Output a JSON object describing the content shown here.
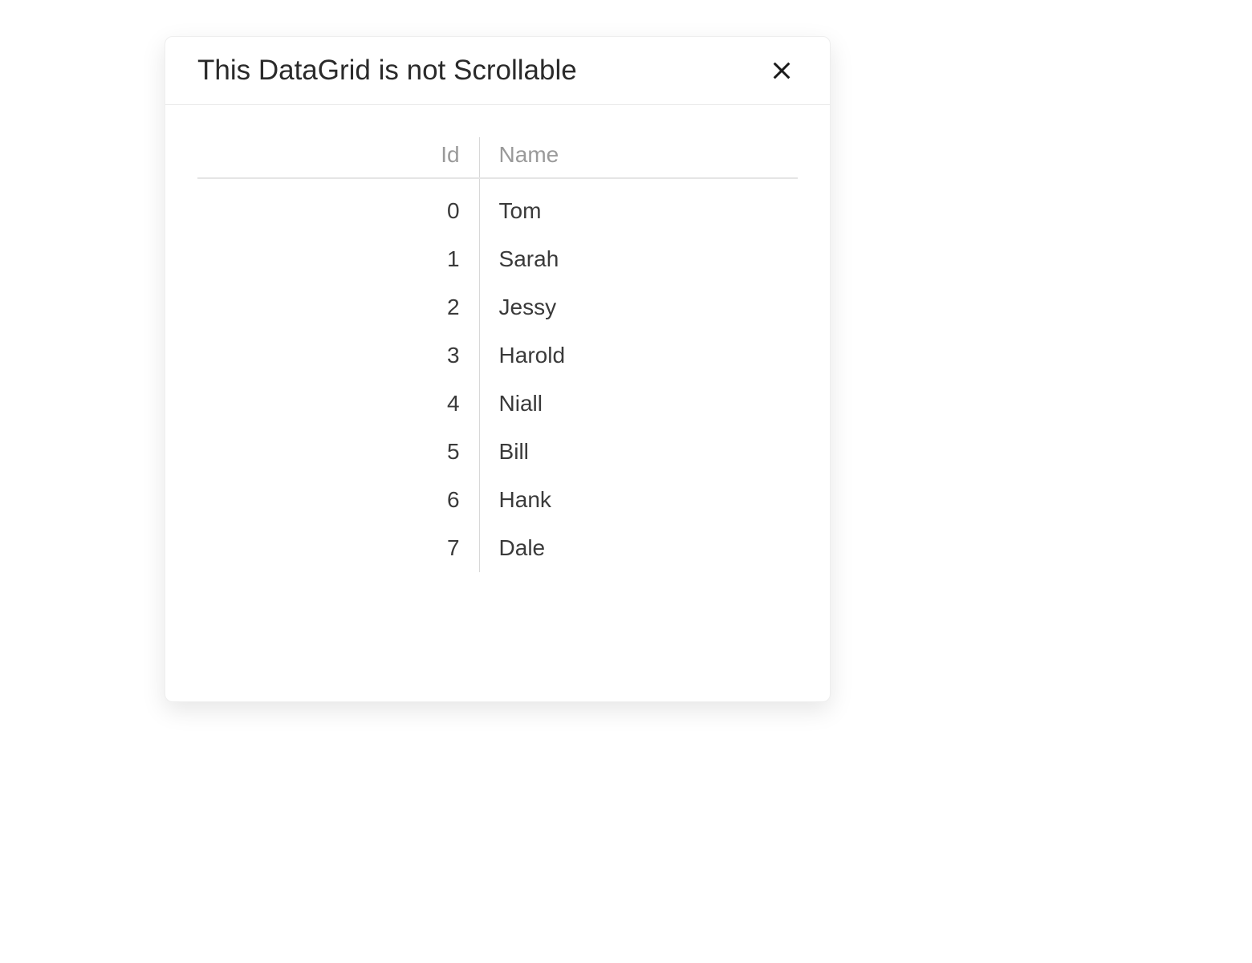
{
  "dialog": {
    "title": "This DataGrid is not Scrollable"
  },
  "grid": {
    "headers": {
      "id": "Id",
      "name": "Name"
    },
    "rows": [
      {
        "id": "0",
        "name": "Tom"
      },
      {
        "id": "1",
        "name": "Sarah"
      },
      {
        "id": "2",
        "name": "Jessy"
      },
      {
        "id": "3",
        "name": "Harold"
      },
      {
        "id": "4",
        "name": "Niall"
      },
      {
        "id": "5",
        "name": "Bill"
      },
      {
        "id": "6",
        "name": "Hank"
      },
      {
        "id": "7",
        "name": "Dale"
      }
    ]
  }
}
